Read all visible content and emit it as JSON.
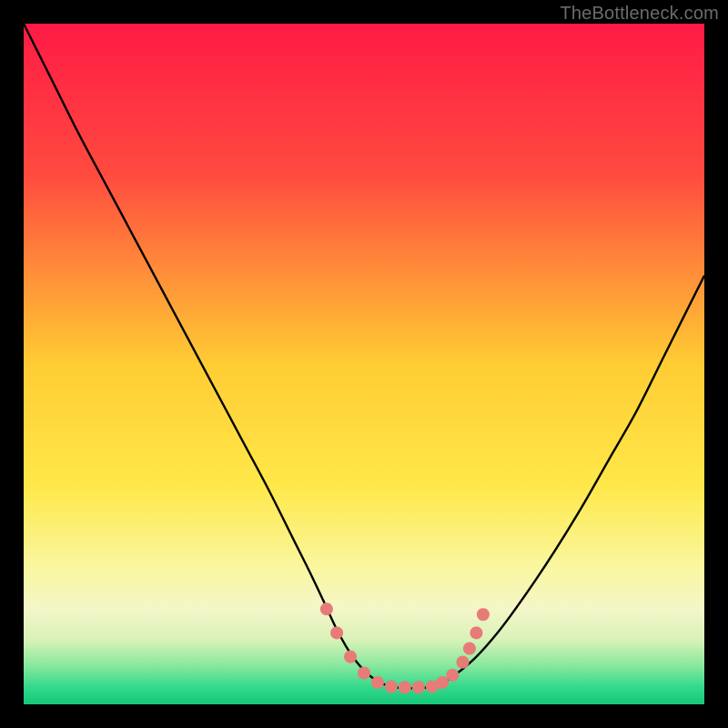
{
  "watermark": "TheBottleneck.com",
  "chart_data": {
    "type": "line",
    "title": "",
    "xlabel": "",
    "ylabel": "",
    "xlim": [
      0,
      100
    ],
    "ylim": [
      0,
      100
    ],
    "gradient_stops": [
      {
        "offset": 0.0,
        "color": "#ff1a45"
      },
      {
        "offset": 0.22,
        "color": "#ff4a3f"
      },
      {
        "offset": 0.5,
        "color": "#ffcc33"
      },
      {
        "offset": 0.68,
        "color": "#ffe84a"
      },
      {
        "offset": 0.8,
        "color": "#f9f7a0"
      },
      {
        "offset": 0.86,
        "color": "#f4f6c8"
      },
      {
        "offset": 0.905,
        "color": "#d9f2b8"
      },
      {
        "offset": 0.94,
        "color": "#8fe9a0"
      },
      {
        "offset": 0.975,
        "color": "#32d98b"
      },
      {
        "offset": 1.0,
        "color": "#17c779"
      }
    ],
    "curve": {
      "x": [
        0,
        4,
        8,
        12,
        16,
        20,
        24,
        28,
        32,
        36,
        40,
        42,
        44,
        46,
        48,
        50,
        52,
        54,
        56,
        58,
        60,
        62,
        66,
        70,
        74,
        78,
        82,
        86,
        90,
        94,
        98,
        100
      ],
      "y": [
        100,
        92,
        84,
        76.5,
        69,
        61.5,
        54,
        46.5,
        39,
        31.5,
        23.5,
        19.5,
        15.3,
        11,
        7.5,
        5,
        3.4,
        2.6,
        2.4,
        2.4,
        2.6,
        3.4,
        6.5,
        11,
        16.5,
        22.5,
        29,
        36,
        43,
        51,
        59,
        63
      ]
    },
    "marker_band": {
      "points": [
        {
          "x": 44.5,
          "y": 14.0
        },
        {
          "x": 46.0,
          "y": 10.5
        },
        {
          "x": 48.0,
          "y": 7.0
        },
        {
          "x": 50.0,
          "y": 4.6
        },
        {
          "x": 52.0,
          "y": 3.2
        },
        {
          "x": 54.0,
          "y": 2.6
        },
        {
          "x": 56.0,
          "y": 2.5
        },
        {
          "x": 58.0,
          "y": 2.5
        },
        {
          "x": 60.0,
          "y": 2.6
        },
        {
          "x": 61.5,
          "y": 3.2
        },
        {
          "x": 63.0,
          "y": 4.3
        },
        {
          "x": 64.5,
          "y": 6.2
        },
        {
          "x": 65.5,
          "y": 8.2
        },
        {
          "x": 66.5,
          "y": 10.5
        },
        {
          "x": 67.5,
          "y": 13.2
        }
      ],
      "color": "#e77b78",
      "radius": 7
    }
  }
}
